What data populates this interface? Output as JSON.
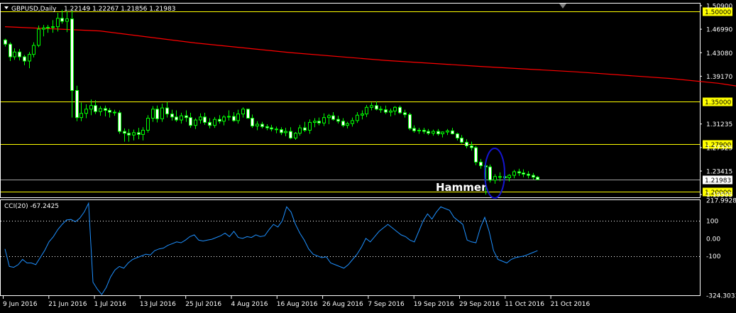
{
  "header": {
    "symbol": "GBPUSD,Daily",
    "ohlc": "1.22149 1.22267 1.21856 1.21983"
  },
  "indicator": {
    "label": "CCI(20) -67.2425"
  },
  "annotation": {
    "text": "Hammer"
  },
  "colors": {
    "background": "#000000",
    "candle": "#00ff00",
    "candle_body_up": "#000000",
    "candle_body_down": "#ffffff",
    "ma_line": "#ff0000",
    "level_line": "#ffff00",
    "level_label_bg": "#ffff00",
    "cci_line": "#1e90ff",
    "grid_dotted": "#ffffff",
    "highlight_ellipse": "#1515d0",
    "current_price_line": "#a0a0a0"
  },
  "chart_data": [
    {
      "type": "candlestick",
      "title": "GBPUSD,Daily",
      "price_axis_ticks": [
        "1.50900",
        "1.46990",
        "1.43080",
        "1.39170",
        "1.31235",
        "1.27325",
        "1.23415",
        "1.19505"
      ],
      "ylim": [
        1.1905,
        1.5125
      ],
      "current_price": "1.21983",
      "horizontal_levels": [
        "1.50000",
        "1.35000",
        "1.27900",
        "1.20000"
      ],
      "time_axis_ticks": [
        "9 Jun 2016",
        "21 Jun 2016",
        "1 Jul 2016",
        "13 Jul 2016",
        "25 Jul 2016",
        "4 Aug 2016",
        "16 Aug 2016",
        "26 Aug 2016",
        "7 Sep 2016",
        "19 Sep 2016",
        "29 Sep 2016",
        "11 Oct 2016",
        "21 Oct 2016"
      ],
      "moving_average": [
        {
          "bar": 0,
          "value": 1.474
        },
        {
          "bar": 20,
          "value": 1.467
        },
        {
          "bar": 40,
          "value": 1.447
        },
        {
          "bar": 60,
          "value": 1.431
        },
        {
          "bar": 80,
          "value": 1.418
        },
        {
          "bar": 100,
          "value": 1.408
        },
        {
          "bar": 120,
          "value": 1.399
        },
        {
          "bar": 140,
          "value": 1.388
        },
        {
          "bar": 150,
          "value": 1.38
        },
        {
          "bar": 155,
          "value": 1.374
        }
      ],
      "candles": [
        [
          1.452,
          1.454,
          1.441,
          1.445
        ],
        [
          1.445,
          1.448,
          1.417,
          1.424
        ],
        [
          1.424,
          1.438,
          1.419,
          1.432
        ],
        [
          1.432,
          1.437,
          1.418,
          1.424
        ],
        [
          1.424,
          1.427,
          1.41,
          1.417
        ],
        [
          1.417,
          1.432,
          1.405,
          1.428
        ],
        [
          1.428,
          1.448,
          1.423,
          1.443
        ],
        [
          1.443,
          1.476,
          1.44,
          1.47
        ],
        [
          1.47,
          1.477,
          1.458,
          1.472
        ],
        [
          1.472,
          1.477,
          1.464,
          1.473
        ],
        [
          1.473,
          1.485,
          1.464,
          1.474
        ],
        [
          1.474,
          1.497,
          1.466,
          1.488
        ],
        [
          1.488,
          1.502,
          1.479,
          1.483
        ],
        [
          1.483,
          1.5,
          1.465,
          1.487
        ],
        [
          1.487,
          1.501,
          1.323,
          1.368
        ],
        [
          1.368,
          1.376,
          1.317,
          1.323
        ],
        [
          1.323,
          1.348,
          1.317,
          1.33
        ],
        [
          1.33,
          1.345,
          1.322,
          1.337
        ],
        [
          1.337,
          1.353,
          1.327,
          1.343
        ],
        [
          1.343,
          1.352,
          1.329,
          1.333
        ],
        [
          1.333,
          1.342,
          1.326,
          1.338
        ],
        [
          1.338,
          1.343,
          1.325,
          1.335
        ],
        [
          1.335,
          1.339,
          1.323,
          1.332
        ],
        [
          1.332,
          1.336,
          1.326,
          1.331
        ],
        [
          1.331,
          1.335,
          1.296,
          1.3
        ],
        [
          1.3,
          1.305,
          1.283,
          1.297
        ],
        [
          1.297,
          1.304,
          1.283,
          1.294
        ],
        [
          1.294,
          1.303,
          1.285,
          1.298
        ],
        [
          1.298,
          1.306,
          1.287,
          1.295
        ],
        [
          1.295,
          1.307,
          1.285,
          1.302
        ],
        [
          1.302,
          1.327,
          1.298,
          1.322
        ],
        [
          1.322,
          1.342,
          1.316,
          1.337
        ],
        [
          1.337,
          1.343,
          1.315,
          1.321
        ],
        [
          1.321,
          1.346,
          1.316,
          1.339
        ],
        [
          1.339,
          1.349,
          1.323,
          1.329
        ],
        [
          1.329,
          1.336,
          1.318,
          1.324
        ],
        [
          1.324,
          1.335,
          1.316,
          1.319
        ],
        [
          1.319,
          1.331,
          1.313,
          1.326
        ],
        [
          1.326,
          1.335,
          1.316,
          1.323
        ],
        [
          1.323,
          1.331,
          1.306,
          1.31
        ],
        [
          1.31,
          1.322,
          1.304,
          1.319
        ],
        [
          1.319,
          1.33,
          1.313,
          1.324
        ],
        [
          1.324,
          1.331,
          1.311,
          1.315
        ],
        [
          1.315,
          1.322,
          1.305,
          1.31
        ],
        [
          1.31,
          1.324,
          1.306,
          1.32
        ],
        [
          1.32,
          1.327,
          1.313,
          1.317
        ],
        [
          1.317,
          1.327,
          1.31,
          1.324
        ],
        [
          1.324,
          1.335,
          1.318,
          1.325
        ],
        [
          1.325,
          1.332,
          1.316,
          1.318
        ],
        [
          1.318,
          1.336,
          1.313,
          1.329
        ],
        [
          1.329,
          1.34,
          1.323,
          1.337
        ],
        [
          1.337,
          1.338,
          1.321,
          1.322
        ],
        [
          1.322,
          1.328,
          1.306,
          1.309
        ],
        [
          1.309,
          1.317,
          1.302,
          1.312
        ],
        [
          1.312,
          1.316,
          1.305,
          1.308
        ],
        [
          1.308,
          1.312,
          1.302,
          1.306
        ],
        [
          1.306,
          1.311,
          1.3,
          1.304
        ],
        [
          1.304,
          1.308,
          1.297,
          1.303
        ],
        [
          1.303,
          1.307,
          1.294,
          1.298
        ],
        [
          1.298,
          1.306,
          1.292,
          1.3
        ],
        [
          1.3,
          1.307,
          1.287,
          1.289
        ],
        [
          1.289,
          1.299,
          1.286,
          1.297
        ],
        [
          1.297,
          1.311,
          1.293,
          1.306
        ],
        [
          1.306,
          1.316,
          1.299,
          1.302
        ],
        [
          1.302,
          1.32,
          1.296,
          1.315
        ],
        [
          1.315,
          1.322,
          1.307,
          1.317
        ],
        [
          1.317,
          1.323,
          1.31,
          1.314
        ],
        [
          1.314,
          1.33,
          1.309,
          1.323
        ],
        [
          1.323,
          1.329,
          1.312,
          1.326
        ],
        [
          1.326,
          1.332,
          1.318,
          1.32
        ],
        [
          1.32,
          1.326,
          1.313,
          1.317
        ],
        [
          1.317,
          1.322,
          1.307,
          1.31
        ],
        [
          1.31,
          1.316,
          1.305,
          1.313
        ],
        [
          1.313,
          1.323,
          1.308,
          1.318
        ],
        [
          1.318,
          1.332,
          1.314,
          1.327
        ],
        [
          1.327,
          1.335,
          1.32,
          1.329
        ],
        [
          1.329,
          1.344,
          1.324,
          1.34
        ],
        [
          1.34,
          1.348,
          1.335,
          1.343
        ],
        [
          1.343,
          1.35,
          1.335,
          1.337
        ],
        [
          1.337,
          1.342,
          1.331,
          1.336
        ],
        [
          1.336,
          1.343,
          1.329,
          1.332
        ],
        [
          1.332,
          1.338,
          1.325,
          1.334
        ],
        [
          1.334,
          1.342,
          1.327,
          1.34
        ],
        [
          1.34,
          1.343,
          1.329,
          1.331
        ],
        [
          1.331,
          1.336,
          1.323,
          1.328
        ],
        [
          1.328,
          1.331,
          1.302,
          1.305
        ],
        [
          1.305,
          1.31,
          1.298,
          1.301
        ],
        [
          1.301,
          1.306,
          1.296,
          1.302
        ],
        [
          1.302,
          1.306,
          1.296,
          1.3
        ],
        [
          1.3,
          1.304,
          1.294,
          1.297
        ],
        [
          1.297,
          1.303,
          1.293,
          1.3
        ],
        [
          1.3,
          1.304,
          1.293,
          1.296
        ],
        [
          1.296,
          1.3,
          1.29,
          1.299
        ],
        [
          1.299,
          1.304,
          1.294,
          1.301
        ],
        [
          1.301,
          1.306,
          1.295,
          1.296
        ],
        [
          1.296,
          1.298,
          1.285,
          1.289
        ],
        [
          1.289,
          1.294,
          1.28,
          1.282
        ],
        [
          1.282,
          1.287,
          1.272,
          1.276
        ],
        [
          1.276,
          1.283,
          1.268,
          1.273
        ],
        [
          1.273,
          1.276,
          1.244,
          1.249
        ],
        [
          1.249,
          1.254,
          1.238,
          1.243
        ],
        [
          1.243,
          1.246,
          1.195,
          1.241
        ],
        [
          1.241,
          1.245,
          1.215,
          1.219
        ],
        [
          1.219,
          1.229,
          1.213,
          1.225
        ],
        [
          1.225,
          1.232,
          1.217,
          1.225
        ],
        [
          1.225,
          1.231,
          1.219,
          1.223
        ],
        [
          1.223,
          1.229,
          1.217,
          1.227
        ],
        [
          1.227,
          1.236,
          1.222,
          1.233
        ],
        [
          1.233,
          1.238,
          1.226,
          1.231
        ],
        [
          1.231,
          1.237,
          1.224,
          1.229
        ],
        [
          1.229,
          1.234,
          1.222,
          1.227
        ],
        [
          1.227,
          1.231,
          1.22,
          1.224
        ],
        [
          1.224,
          1.226,
          1.219,
          1.22
        ]
      ]
    },
    {
      "type": "line",
      "title": "CCI(20) -67.2425",
      "axis_ticks": [
        "217.9928",
        "100",
        "0.00",
        "-100",
        "-324.3031"
      ],
      "ylim": [
        -324.3031,
        217.9928
      ],
      "dotted_levels": [
        100,
        -100
      ],
      "values": [
        -60,
        -160,
        -165,
        -150,
        -120,
        -140,
        -140,
        -150,
        -110,
        -70,
        -20,
        10,
        50,
        80,
        105,
        108,
        95,
        115,
        150,
        200,
        -250,
        -290,
        -320,
        -280,
        -220,
        -180,
        -160,
        -170,
        -140,
        -120,
        -110,
        -100,
        -90,
        -95,
        -70,
        -60,
        -55,
        -40,
        -30,
        -20,
        -25,
        -10,
        10,
        20,
        -10,
        -15,
        -10,
        -5,
        5,
        15,
        30,
        10,
        40,
        5,
        0,
        10,
        5,
        20,
        10,
        15,
        50,
        80,
        65,
        100,
        180,
        150,
        80,
        30,
        -10,
        -60,
        -90,
        -100,
        -110,
        -105,
        -140,
        -150,
        -160,
        -170,
        -150,
        -120,
        -90,
        -50,
        0,
        -20,
        10,
        40,
        60,
        80,
        60,
        40,
        20,
        10,
        -10,
        -20,
        40,
        100,
        140,
        110,
        150,
        180,
        170,
        160,
        120,
        100,
        80,
        -10,
        -20,
        -25,
        60,
        120,
        40,
        -70,
        -120,
        -130,
        -140,
        -120,
        -110,
        -105,
        -100,
        -90,
        -80,
        -70
      ]
    }
  ]
}
